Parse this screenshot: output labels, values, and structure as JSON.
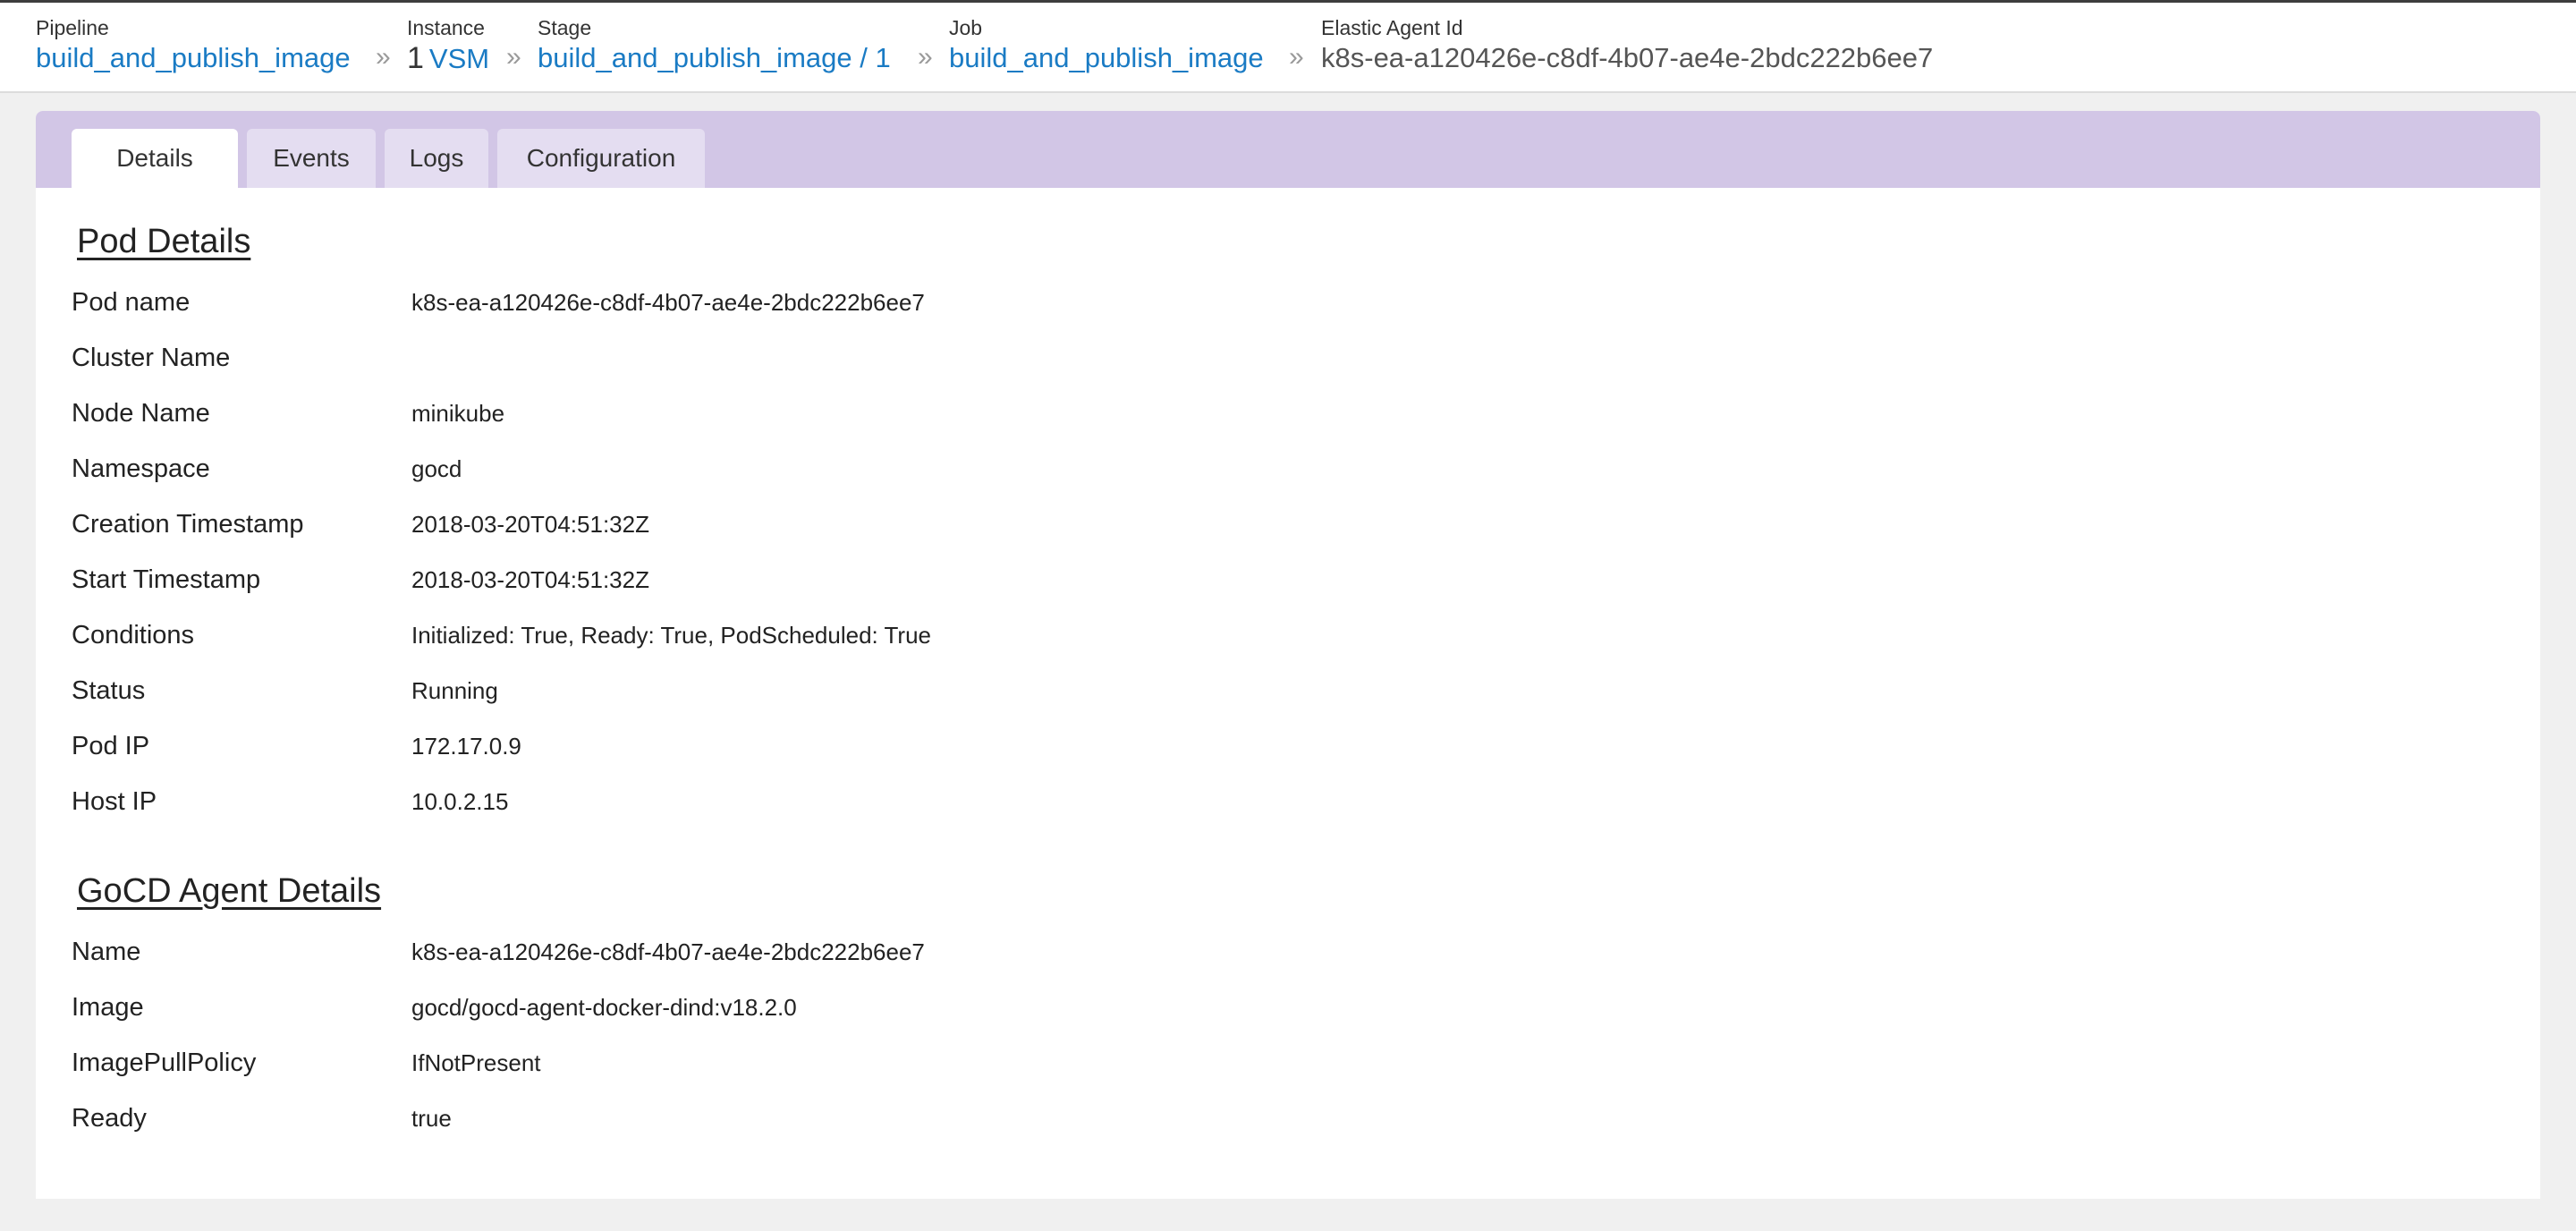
{
  "breadcrumb": {
    "pipeline": {
      "label": "Pipeline",
      "value": "build_and_publish_image"
    },
    "instance": {
      "label": "Instance",
      "counter": "1",
      "value": "VSM"
    },
    "stage": {
      "label": "Stage",
      "value": "build_and_publish_image / 1"
    },
    "job": {
      "label": "Job",
      "value": "build_and_publish_image"
    },
    "agent": {
      "label": "Elastic Agent Id",
      "value": "k8s-ea-a120426e-c8df-4b07-ae4e-2bdc222b6ee7"
    },
    "separator": "»"
  },
  "tabs": [
    {
      "label": "Details",
      "active": true
    },
    {
      "label": "Events"
    },
    {
      "label": "Logs"
    },
    {
      "label": "Configuration"
    }
  ],
  "pod_details": {
    "title": "Pod Details",
    "rows": [
      {
        "key": "Pod name",
        "value": "k8s-ea-a120426e-c8df-4b07-ae4e-2bdc222b6ee7"
      },
      {
        "key": "Cluster Name",
        "value": ""
      },
      {
        "key": "Node Name",
        "value": "minikube"
      },
      {
        "key": "Namespace",
        "value": "gocd"
      },
      {
        "key": "Creation Timestamp",
        "value": "2018-03-20T04:51:32Z"
      },
      {
        "key": "Start Timestamp",
        "value": "2018-03-20T04:51:32Z"
      },
      {
        "key": "Conditions",
        "value": "Initialized: True, Ready: True, PodScheduled: True"
      },
      {
        "key": "Status",
        "value": "Running"
      },
      {
        "key": "Pod IP",
        "value": "172.17.0.9"
      },
      {
        "key": "Host IP",
        "value": "10.0.2.15"
      }
    ]
  },
  "agent_details": {
    "title": "GoCD Agent Details",
    "rows": [
      {
        "key": "Name",
        "value": "k8s-ea-a120426e-c8df-4b07-ae4e-2bdc222b6ee7"
      },
      {
        "key": "Image",
        "value": "gocd/gocd-agent-docker-dind:v18.2.0"
      },
      {
        "key": "ImagePullPolicy",
        "value": "IfNotPresent"
      },
      {
        "key": "Ready",
        "value": "true"
      }
    ]
  },
  "colors": {
    "link": "#1a7bc4",
    "tabbar": "#d2c6e6",
    "tab_inactive": "#e4ddf1",
    "page_bg": "#f0f0f0"
  }
}
